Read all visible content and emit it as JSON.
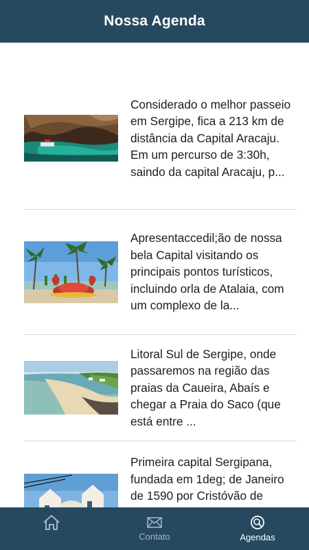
{
  "header": {
    "title": "Nossa Agenda"
  },
  "agenda": {
    "items": [
      {
        "text": "Considerado o melhor passeio em Sergipe, fica a 213 km de distância da Capital Aracaju. Em um percurso de 3:30h, saindo da capital Aracaju, p..."
      },
      {
        "text": "Apresentaccedil;ão de nossa bela Capital visitando os principais pontos turísticos, incluindo orla de Atalaia, com um complexo de la..."
      },
      {
        "text": "Litoral Sul de Sergipe, onde passaremos na região das praias da Caueira, Abaís e chegar a Praia do Saco (que está entre ..."
      },
      {
        "text": "Primeira capital Sergipana, fundada em 1deg; de Janeiro de 1590 por Cristóvão de Barros e que permaneceu sendo nossa"
      }
    ]
  },
  "tabbar": {
    "tabs": [
      {
        "label": "",
        "icon": "home-icon"
      },
      {
        "label": "Contato",
        "icon": "envelope-icon"
      },
      {
        "label": "Agendas",
        "icon": "search-icon"
      }
    ],
    "active_tab": "Agendas"
  },
  "colors": {
    "bar": "#264960",
    "tab_active": "#ffffff",
    "tab_inactive": "#a8b4bf"
  }
}
